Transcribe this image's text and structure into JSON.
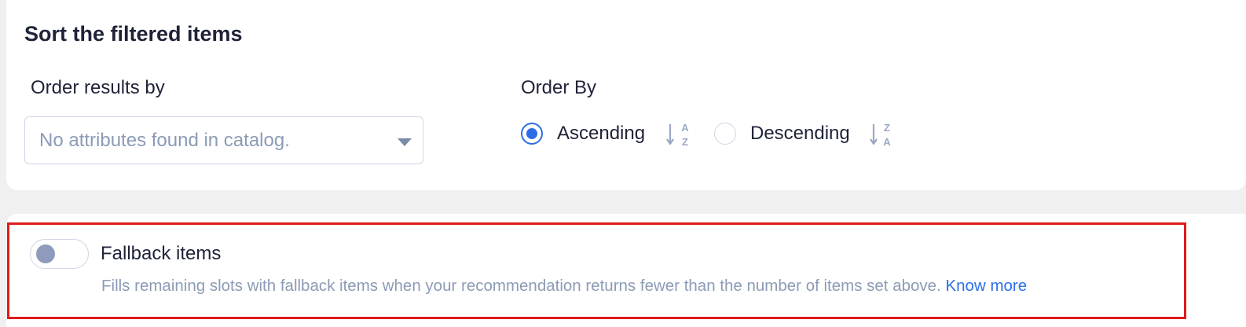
{
  "sort_section": {
    "title": "Sort the filtered items",
    "order_results_label": "Order results by",
    "select_placeholder": "No attributes found in catalog.",
    "order_by_label": "Order By",
    "options": [
      {
        "label": "Ascending",
        "selected": true,
        "icon": "sort-a-z-icon",
        "icon_top": "A",
        "icon_bottom": "Z"
      },
      {
        "label": "Descending",
        "selected": false,
        "icon": "sort-z-a-icon",
        "icon_top": "Z",
        "icon_bottom": "A"
      }
    ]
  },
  "fallback_section": {
    "toggle_label": "Fallback items",
    "toggle_on": false,
    "description": "Fills remaining slots with fallback items when your recommendation returns fewer than the number of items set above.",
    "link_text": "Know more"
  },
  "colors": {
    "accent": "#2d6ee8",
    "highlight_border": "#e01b1b",
    "text_primary": "#1f2338",
    "text_muted": "#8c9bb5",
    "icon_muted": "#9aa8c4"
  }
}
